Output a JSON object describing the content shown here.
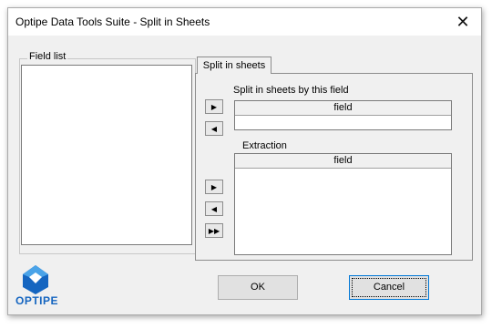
{
  "window": {
    "title": "Optipe Data Tools Suite - Split in Sheets",
    "close_glyph": "✕"
  },
  "field_list": {
    "label": "Field list",
    "items": []
  },
  "tab": {
    "label": "Split in sheets"
  },
  "split_section": {
    "label": "Split in sheets by this field",
    "column_header": "field",
    "buttons": {
      "add": "▶",
      "remove": "◀"
    }
  },
  "extraction_section": {
    "label": "Extraction",
    "column_header": "field",
    "buttons": {
      "add": "▶",
      "remove": "◀",
      "add_all": "▶▶"
    }
  },
  "footer": {
    "ok_label": "OK",
    "cancel_label": "Cancel",
    "logo_text": "OPTIPE"
  },
  "colors": {
    "logo_blue": "#1565c0",
    "logo_light": "#4aa3e8",
    "focus_border": "#0078d7"
  }
}
